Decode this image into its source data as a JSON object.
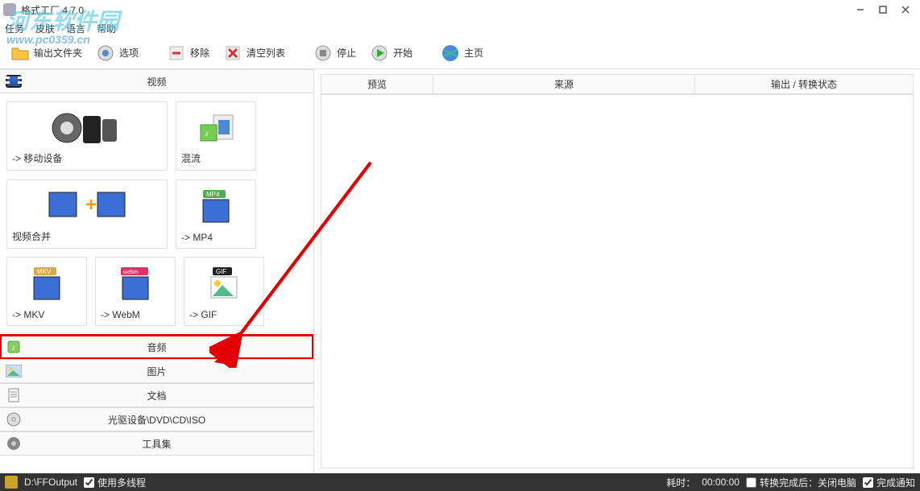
{
  "window": {
    "title": "格式工厂 4.7.0"
  },
  "watermark": {
    "line1": "河东软件园",
    "line2": "www.pc0359.cn"
  },
  "menubar": [
    "任务",
    "皮肤",
    "语言",
    "帮助"
  ],
  "toolbar": {
    "output_folder": "输出文件夹",
    "options": "选项",
    "remove": "移除",
    "clear_list": "清空列表",
    "stop": "停止",
    "start": "开始",
    "home": "主页"
  },
  "sidebar": {
    "categories": {
      "video": "视频",
      "audio": "音频",
      "image": "图片",
      "document": "文档",
      "rom": "光驱设备\\DVD\\CD\\ISO",
      "toolkit": "工具集"
    },
    "video_tiles": {
      "mobile": "-> 移动设备",
      "mux": "混流",
      "merge": "视频合并",
      "mp4": "-> MP4",
      "mkv": "-> MKV",
      "webm": "-> WebM",
      "gif": "-> GIF"
    }
  },
  "content": {
    "headers": {
      "preview": "预览",
      "source": "来源",
      "output_status": "输出 / 转换状态"
    }
  },
  "statusbar": {
    "output_path": "D:\\FFOutput",
    "multithread": "使用多线程",
    "elapsed_label": "耗时：",
    "elapsed_value": "00:00:00",
    "after_convert": "转换完成后：关闭电脑",
    "done_notify": "完成通知"
  }
}
